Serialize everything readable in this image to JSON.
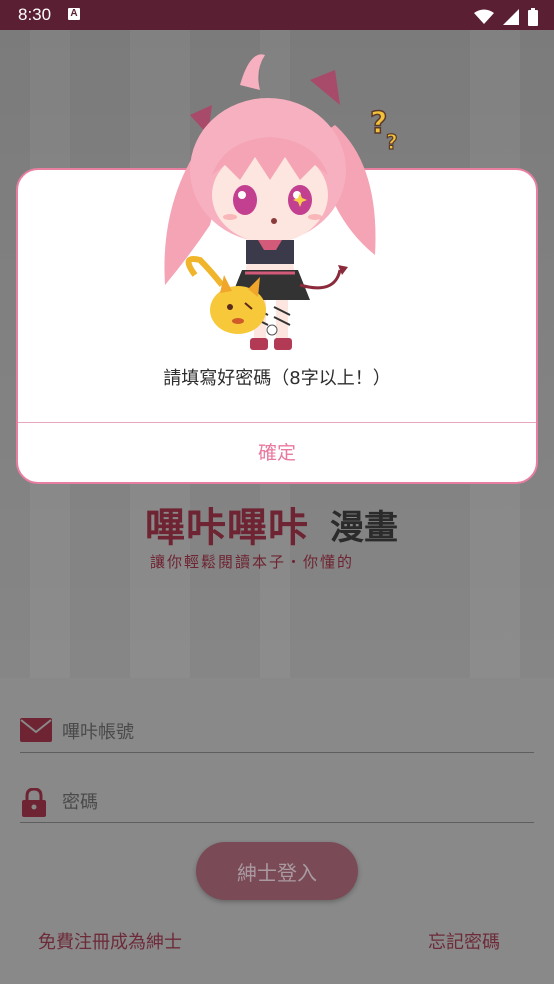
{
  "status_bar": {
    "time": "8:30",
    "notification_icon": "A",
    "icons": [
      "wifi-icon",
      "signal-icon",
      "battery-icon"
    ]
  },
  "logo": {
    "title": "嗶咔嗶咔",
    "subtitle": "漫畫",
    "tagline": "讓你輕鬆閱讀本子・你懂的"
  },
  "login": {
    "account_placeholder": "嗶咔帳號",
    "password_placeholder": "密碼",
    "login_button": "紳士登入",
    "register_link": "免費注冊成為紳士",
    "forgot_link": "忘記密碼"
  },
  "dialog": {
    "message": "請填寫好密碼（8字以上！）",
    "confirm": "確定"
  },
  "colors": {
    "accent": "#e9799e",
    "status_bar": "#5b1f33",
    "brand_dark": "#6e2432"
  }
}
